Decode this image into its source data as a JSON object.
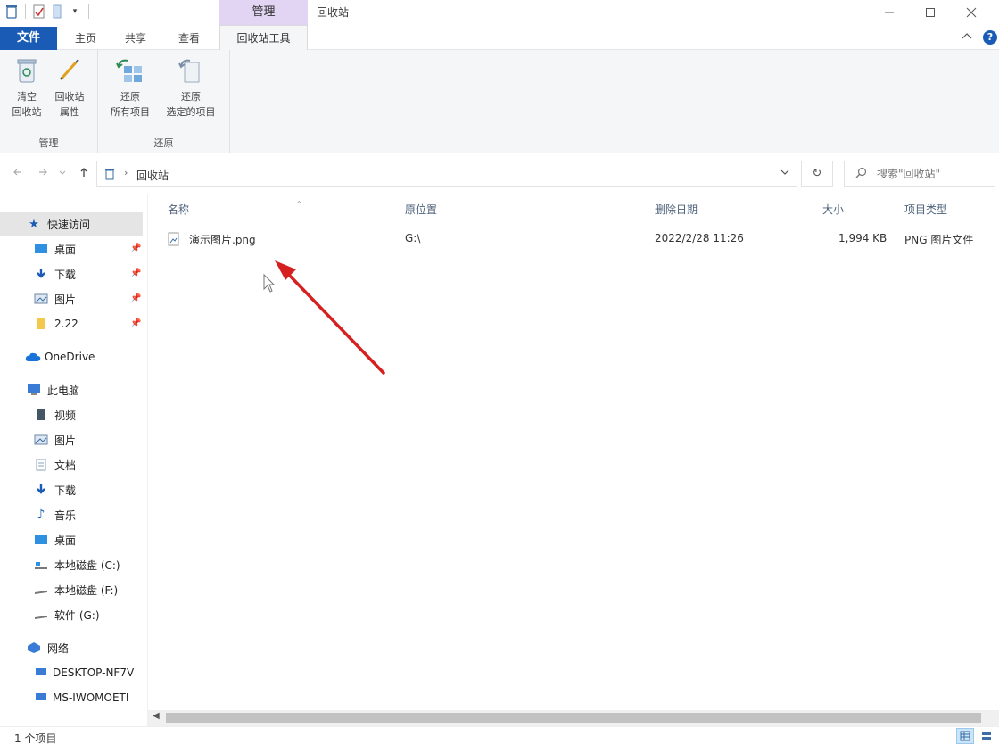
{
  "titlebar": {
    "manage_tab": "管理",
    "window_title": "回收站",
    "qat_dropdown": "▾"
  },
  "tabs": {
    "file": "文件",
    "home": "主页",
    "share": "共享",
    "view": "查看",
    "recycle_tools": "回收站工具"
  },
  "ribbon": {
    "groups": [
      {
        "label": "管理",
        "buttons": [
          {
            "line1": "清空",
            "line2": "回收站"
          },
          {
            "line1": "回收站",
            "line2": "属性"
          }
        ]
      },
      {
        "label": "还原",
        "buttons": [
          {
            "line1": "还原",
            "line2": "所有项目"
          },
          {
            "line1": "还原",
            "line2": "选定的项目"
          }
        ]
      }
    ]
  },
  "address": {
    "path": "回收站",
    "search_placeholder": "搜索\"回收站\""
  },
  "nav": {
    "quick_access": "快速访问",
    "quick_items": [
      {
        "label": "桌面"
      },
      {
        "label": "下载"
      },
      {
        "label": "图片"
      },
      {
        "label": "2.22"
      }
    ],
    "onedrive": "OneDrive",
    "this_pc": "此电脑",
    "pc_items": [
      {
        "label": "视频"
      },
      {
        "label": "图片"
      },
      {
        "label": "文档"
      },
      {
        "label": "下载"
      },
      {
        "label": "音乐"
      },
      {
        "label": "桌面"
      },
      {
        "label": "本地磁盘 (C:)"
      },
      {
        "label": "本地磁盘 (F:)"
      },
      {
        "label": "软件 (G:)"
      }
    ],
    "network": "网络",
    "network_items": [
      {
        "label": "DESKTOP-NF7V"
      },
      {
        "label": "MS-IWOMOETI"
      }
    ]
  },
  "columns": {
    "name": "名称",
    "original_location": "原位置",
    "date_deleted": "删除日期",
    "size": "大小",
    "type": "项目类型"
  },
  "files": [
    {
      "name": "演示图片.png",
      "original_location": "G:\\",
      "date_deleted": "2022/2/28 11:26",
      "size": "1,994 KB",
      "type": "PNG 图片文件"
    }
  ],
  "status": {
    "item_count": "1 个项目"
  },
  "colors": {
    "file_tab": "#1a5cb5",
    "manage_tab": "#e2d4f3",
    "annotation_arrow": "#d62020"
  }
}
